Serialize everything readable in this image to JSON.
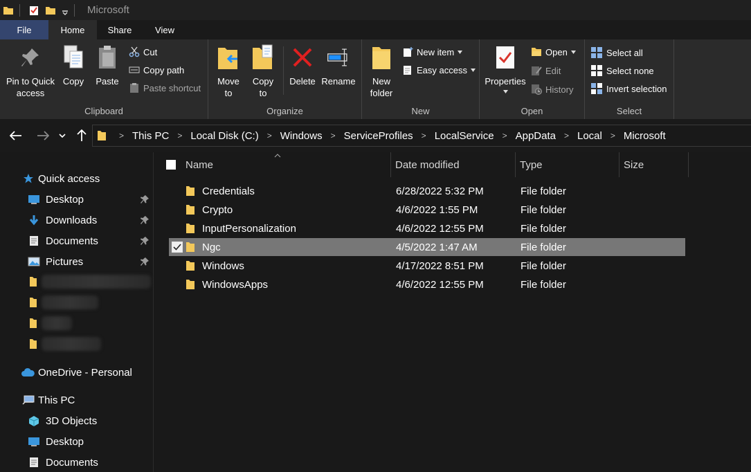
{
  "window": {
    "title": "Microsoft"
  },
  "tabs": {
    "file": "File",
    "home": "Home",
    "share": "Share",
    "view": "View"
  },
  "ribbon": {
    "clipboard": {
      "label": "Clipboard",
      "pin_line1": "Pin to Quick",
      "pin_line2": "access",
      "copy": "Copy",
      "paste": "Paste",
      "cut": "Cut",
      "copy_path": "Copy path",
      "paste_shortcut": "Paste shortcut"
    },
    "organize": {
      "label": "Organize",
      "move_line1": "Move",
      "move_line2": "to",
      "copy_line1": "Copy",
      "copy_line2": "to",
      "delete": "Delete",
      "rename": "Rename"
    },
    "new": {
      "label": "New",
      "folder_line1": "New",
      "folder_line2": "folder",
      "new_item": "New item",
      "easy_access": "Easy access"
    },
    "open": {
      "label": "Open",
      "properties": "Properties",
      "open": "Open",
      "edit": "Edit",
      "history": "History"
    },
    "select": {
      "label": "Select",
      "select_all": "Select all",
      "select_none": "Select none",
      "invert": "Invert selection"
    }
  },
  "breadcrumb": [
    "This PC",
    "Local Disk (C:)",
    "Windows",
    "ServiceProfiles",
    "LocalService",
    "AppData",
    "Local",
    "Microsoft"
  ],
  "nav": {
    "quick_access": "Quick access",
    "desktop": "Desktop",
    "downloads": "Downloads",
    "documents": "Documents",
    "pictures": "Pictures",
    "onedrive": "OneDrive - Personal",
    "this_pc": "This PC",
    "objects3d": "3D Objects",
    "pc_desktop": "Desktop",
    "pc_documents": "Documents"
  },
  "columns": {
    "name": "Name",
    "date": "Date modified",
    "type": "Type",
    "size": "Size"
  },
  "files": [
    {
      "name": "Credentials",
      "date": "6/28/2022 5:32 PM",
      "type": "File folder"
    },
    {
      "name": "Crypto",
      "date": "4/6/2022 1:55 PM",
      "type": "File folder"
    },
    {
      "name": "InputPersonalization",
      "date": "4/6/2022 12:55 PM",
      "type": "File folder"
    },
    {
      "name": "Ngc",
      "date": "4/5/2022 1:47 AM",
      "type": "File folder"
    },
    {
      "name": "Windows",
      "date": "4/17/2022 8:51 PM",
      "type": "File folder"
    },
    {
      "name": "WindowsApps",
      "date": "4/6/2022 12:55 PM",
      "type": "File folder"
    }
  ],
  "colors": {
    "file_tab": "#34456e",
    "folder": "#f3c85a",
    "selection": "#777777",
    "accent_blue": "#1e90ff"
  }
}
